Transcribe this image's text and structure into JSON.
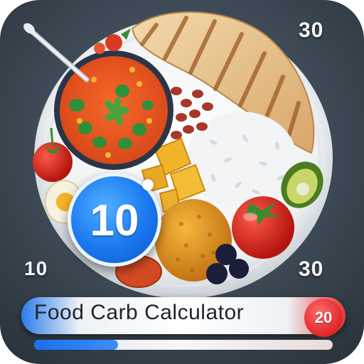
{
  "app": {
    "title": "Food Carb Calculator"
  },
  "numbers": {
    "top_right": "30",
    "left": "10",
    "right": "30",
    "badge": "10",
    "end_marker": "20"
  },
  "progress": {
    "fraction": 0.28
  },
  "colors": {
    "accent_blue": "#1a78f0",
    "accent_red": "#e02525",
    "background": "#3c4853"
  },
  "icons": {
    "plate": "plate-icon",
    "soup": "soup-bowl-icon",
    "spoon": "spoon-icon",
    "bread": "flatbread-icon",
    "rice": "rice-icon",
    "tomato": "tomato-icon"
  }
}
